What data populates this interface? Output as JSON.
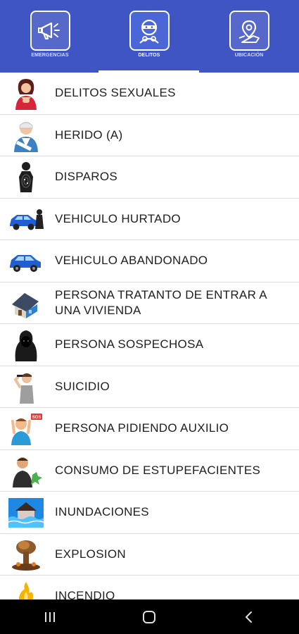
{
  "tabs": [
    {
      "label": "EMERGENCIAS",
      "icon": "megaphone-icon",
      "active": false
    },
    {
      "label": "DELITOS",
      "icon": "thief-mask-icon",
      "active": true
    },
    {
      "label": "UBICACIÓN",
      "icon": "map-pin-icon",
      "active": false
    }
  ],
  "items": [
    {
      "label": "DELITOS SEXUALES",
      "icon": "distressed-woman-icon"
    },
    {
      "label": "HERIDO (A)",
      "icon": "injured-person-icon"
    },
    {
      "label": "DISPAROS",
      "icon": "shooting-target-icon"
    },
    {
      "label": "VEHICULO HURTADO",
      "icon": "stolen-car-icon"
    },
    {
      "label": "VEHICULO ABANDONADO",
      "icon": "abandoned-car-icon"
    },
    {
      "label": "PERSONA TRATANTO DE ENTRAR A UNA VIVIENDA",
      "icon": "house-break-in-icon"
    },
    {
      "label": "PERSONA SOSPECHOSA",
      "icon": "hooded-person-icon"
    },
    {
      "label": "SUICIDIO",
      "icon": "gun-to-head-icon"
    },
    {
      "label": "PERSONA PIDIENDO AUXILIO",
      "icon": "sos-person-icon"
    },
    {
      "label": "CONSUMO DE ESTUPEFACIENTES",
      "icon": "drug-use-icon"
    },
    {
      "label": "INUNDACIONES",
      "icon": "flooded-house-icon"
    },
    {
      "label": "EXPLOSION",
      "icon": "explosion-icon"
    },
    {
      "label": "INCENDIO",
      "icon": "fire-icon"
    }
  ],
  "navbar": {
    "recent": "recent-apps-icon",
    "home": "home-icon",
    "back": "back-icon"
  },
  "colors": {
    "header": "#3f55c4",
    "text": "#202020",
    "divider": "#dcdcdc"
  }
}
